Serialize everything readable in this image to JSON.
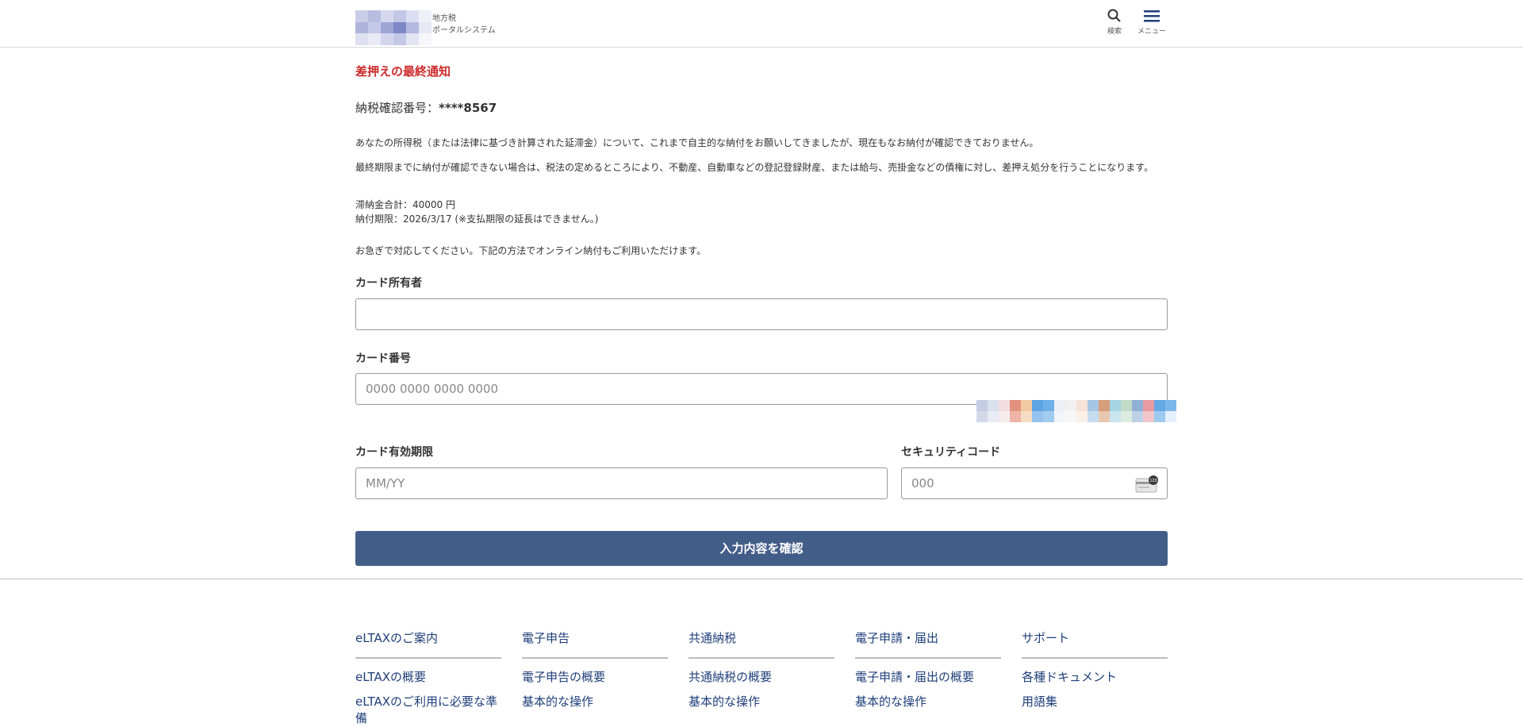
{
  "header": {
    "logo_line1": "地方税",
    "logo_line2": "ポータルシステム",
    "search_label": "検索",
    "menu_label": "メニュー",
    "accent_color": "#1f3f7a"
  },
  "notice": {
    "title": "差押えの最終通知",
    "tax_no_label": "納税確認番号：",
    "tax_no_value": "****8567",
    "para1": "あなたの所得税（または法律に基づき計算された延滞金）について、これまで自主的な納付をお願いしてきましたが、現在もなお納付が確認できておりません。",
    "para2": "最終期限までに納付が確認できない場合は、税法の定めるところにより、不動産、自動車などの登記登録財産、または給与、売掛金などの債権に対し、差押え処分を行うことになります。",
    "amount": "滞納金合計：40000 円",
    "deadline": "納付期限：2026/3/17 (※支払期限の延長はできません。)",
    "urge": "お急ぎで対応してください。下記の方法でオンライン納付もご利用いただけます。",
    "title_color": "#cc2b2b"
  },
  "form": {
    "holder_label": "カード所有者",
    "holder_value": "",
    "number_label": "カード番号",
    "number_placeholder": "0000 0000 0000 0000",
    "expiry_label": "カード有効期限",
    "expiry_placeholder": "MM/YY",
    "cvc_label": "セキュリティコード",
    "cvc_placeholder": "000",
    "cvc_icon_text": "123",
    "submit_label": "入力内容を確認",
    "button_color": "#435d89"
  },
  "footer": {
    "columns": [
      {
        "heading": "eLTAXのご案内",
        "links": [
          "eLTAXの概要",
          "eLTAXのご利用に必要な準備"
        ]
      },
      {
        "heading": "電子申告",
        "links": [
          "電子申告の概要",
          "基本的な操作"
        ]
      },
      {
        "heading": "共通納税",
        "links": [
          "共通納税の概要",
          "基本的な操作"
        ]
      },
      {
        "heading": "電子申請・届出",
        "links": [
          "電子申請・届出の概要",
          "基本的な操作"
        ]
      },
      {
        "heading": "サポート",
        "links": [
          "各種ドキュメント",
          "用語集"
        ]
      }
    ],
    "link_color": "#1f3f7a"
  }
}
